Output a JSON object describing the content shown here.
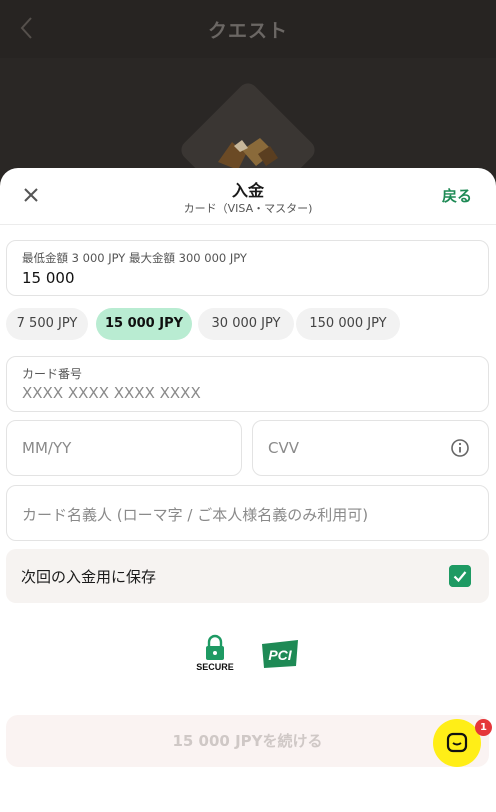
{
  "background": {
    "title": "クエスト"
  },
  "sheet": {
    "title": "入金",
    "subtitle": "カード（VISA・マスター)",
    "back_label": "戻る"
  },
  "amount": {
    "limits_label": "最低金額 3 000 JPY 最大金額 300 000 JPY",
    "value": "15 000"
  },
  "quick_amounts": [
    {
      "label": "7 500 JPY",
      "selected": false
    },
    {
      "label": "15 000 JPY",
      "selected": true
    },
    {
      "label": "30 000 JPY",
      "selected": false
    },
    {
      "label": "150 000 JPY",
      "selected": false
    }
  ],
  "card_number": {
    "label": "カード番号",
    "placeholder": "XXXX XXXX XXXX XXXX"
  },
  "expiry": {
    "placeholder": "MM/YY"
  },
  "cvv": {
    "placeholder": "CVV"
  },
  "cardholder": {
    "placeholder": "カード名義人 (ローマ字 / ご本人様名義のみ利用可)"
  },
  "save_card": {
    "label": "次回の入金用に保存",
    "checked": true
  },
  "badges": {
    "secure_text": "SECURE",
    "pci_text": "PCI"
  },
  "continue_button": {
    "label": "15 000 JPYを続ける"
  },
  "chat": {
    "badge_count": "1"
  },
  "colors": {
    "accent": "#1e8a55",
    "chip_active": "#b9ecd2",
    "checkbox": "#1e9a63",
    "chat": "#ffee17",
    "badge": "#e5373a"
  }
}
